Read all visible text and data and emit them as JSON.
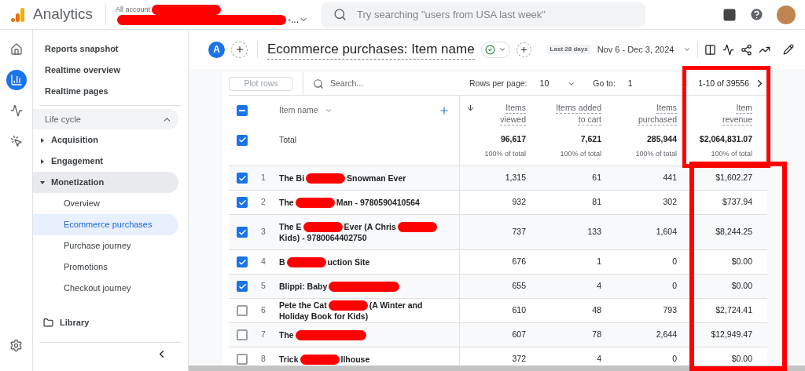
{
  "app": {
    "name": "Analytics",
    "account_label": "All account",
    "property_tail": "-..."
  },
  "search": {
    "placeholder": "Try searching \"users from USA last week\""
  },
  "rail": [
    {
      "kind": "home",
      "selected": false
    },
    {
      "kind": "reports",
      "selected": true
    },
    {
      "kind": "explore",
      "selected": false
    },
    {
      "kind": "advertising",
      "selected": false
    }
  ],
  "sidebar": {
    "items": [
      {
        "label": "Reports snapshot"
      },
      {
        "label": "Realtime overview"
      },
      {
        "label": "Realtime pages"
      }
    ],
    "section": {
      "label": "Life cycle",
      "expanded": true,
      "groups": [
        {
          "label": "Acquisition",
          "expanded": false
        },
        {
          "label": "Engagement",
          "expanded": false
        },
        {
          "label": "Monetization",
          "expanded": true,
          "children": [
            {
              "label": "Overview",
              "selected": false
            },
            {
              "label": "Ecommerce purchases",
              "selected": true
            },
            {
              "label": "Purchase journey",
              "selected": false
            },
            {
              "label": "Promotions",
              "selected": false
            },
            {
              "label": "Checkout journey",
              "selected": false
            }
          ]
        }
      ]
    },
    "library": "Library"
  },
  "report": {
    "avatar": "A",
    "title": "Ecommerce purchases: Item name",
    "date_label": "Last 28 days",
    "date_range": "Nov 6 - Dec 3, 2024"
  },
  "toolbar": {
    "plot_rows": "Plot rows",
    "search_placeholder": "Search...",
    "rows_per_page_label": "Rows per page:",
    "rows_per_page": "10",
    "goto_label": "Go to:",
    "goto": "1",
    "range": "1-10 of 39556"
  },
  "table": {
    "select_all_mixed": true,
    "dimension": "Item name",
    "columns": [
      {
        "label": "Items viewed",
        "sorted": true
      },
      {
        "label": "Items added to cart",
        "sorted": false
      },
      {
        "label": "Items purchased",
        "sorted": false
      },
      {
        "label": "Item revenue",
        "sorted": false
      }
    ],
    "total": {
      "label": "Total",
      "checked": true,
      "values": [
        "96,617",
        "7,621",
        "285,944",
        "$2,064,831.07"
      ],
      "shares": [
        "100% of total",
        "100% of total",
        "100% of total",
        "100% of total"
      ]
    },
    "rows": [
      {
        "index": "1",
        "checked": true,
        "name_parts": [
          "The Bi",
          "Snowman Ever"
        ],
        "values": [
          "1,315",
          "61",
          "441",
          "$1,602.27"
        ]
      },
      {
        "index": "2",
        "checked": true,
        "name_parts": [
          "The",
          "Man - 9780590410564"
        ],
        "values": [
          "932",
          "81",
          "302",
          "$737.94"
        ]
      },
      {
        "index": "3",
        "checked": true,
        "name_parts": [
          "The E",
          "Ever (A Chris",
          "Kids) - 9780064402750"
        ],
        "values": [
          "737",
          "133",
          "1,604",
          "$8,244.25"
        ]
      },
      {
        "index": "4",
        "checked": true,
        "name_parts": [
          "B",
          "uction Site"
        ],
        "values": [
          "676",
          "1",
          "0",
          "$0.00"
        ]
      },
      {
        "index": "5",
        "checked": true,
        "name_parts": [
          "Blippi: Baby"
        ],
        "trailing_redaction": true,
        "values": [
          "655",
          "4",
          "0",
          "$0.00"
        ]
      },
      {
        "index": "6",
        "checked": false,
        "name_parts": [
          "Pete the Cat",
          "(A Winter and Holiday Book for Kids)"
        ],
        "values": [
          "610",
          "48",
          "793",
          "$2,724.41"
        ]
      },
      {
        "index": "7",
        "checked": false,
        "name_parts": [
          "The"
        ],
        "trailing_redaction": true,
        "values": [
          "607",
          "78",
          "2,644",
          "$12,949.47"
        ]
      },
      {
        "index": "8",
        "checked": false,
        "name_parts": [
          "Trick",
          "llhouse"
        ],
        "values": [
          "372",
          "4",
          "0",
          "$0.00"
        ]
      }
    ]
  }
}
